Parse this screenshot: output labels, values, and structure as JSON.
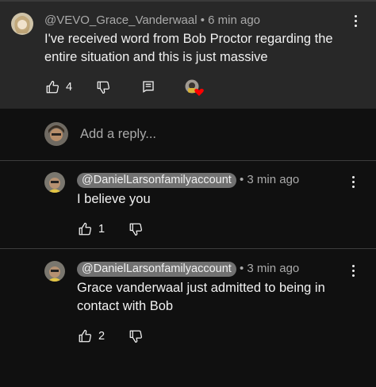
{
  "parent_comment": {
    "author": "@VEVO_Grace_Vanderwaal",
    "time": " • 6 min ago",
    "text_line1": "I've received word from Bob Proctor regarding the",
    "text_line2": "entire situation and this is just massive",
    "like_count": "4",
    "icons": [
      "like-icon",
      "dislike-icon",
      "reply-icon",
      "creator-heart-icon",
      "more-options-icon"
    ],
    "colors": {
      "heart": "#ff0000",
      "background": "#282828"
    }
  },
  "reply_input": {
    "placeholder": "Add a reply..."
  },
  "replies": [
    {
      "author": "@DanielLarsonfamilyaccount",
      "time": " • 3 min ago",
      "text_line1": "I believe you",
      "text_line2": "",
      "like_count": "1"
    },
    {
      "author": "@DanielLarsonfamilyaccount",
      "time": " • 3 min ago",
      "text_line1": "Grace vanderwaal just admitted to being in",
      "text_line2": "contact with Bob",
      "like_count": "2"
    }
  ],
  "colors": {
    "page_background": "#101010",
    "chip": "#717171",
    "secondary_text": "#aaaaaa"
  }
}
